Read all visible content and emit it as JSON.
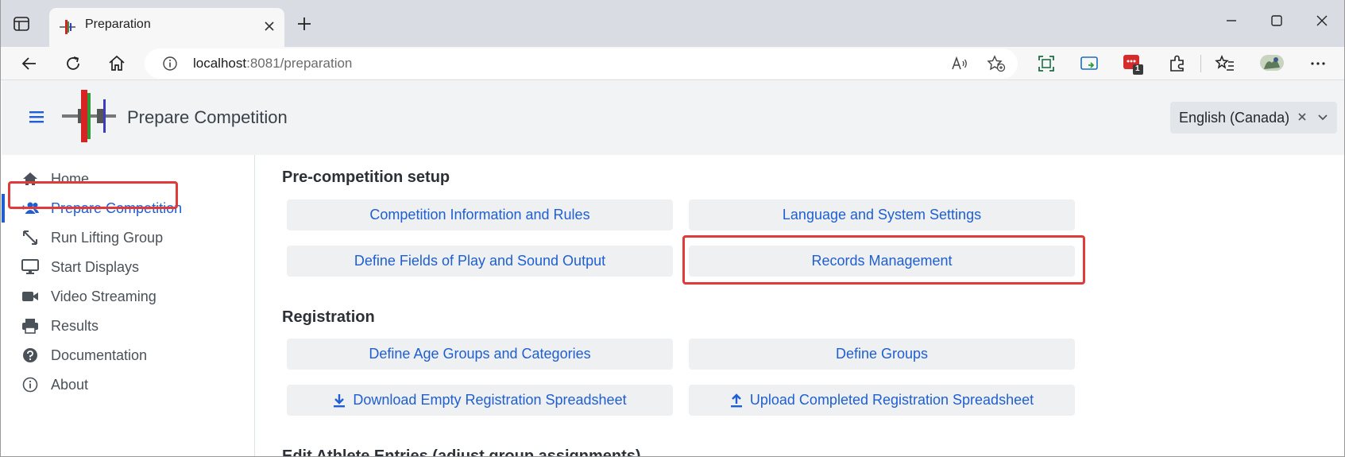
{
  "browser": {
    "tab_title": "Preparation",
    "url_host": "localhost",
    "url_rest": ":8081/preparation",
    "notification_badge": "1"
  },
  "header": {
    "title": "Prepare Competition",
    "language": "English (Canada)"
  },
  "sidebar": {
    "items": [
      {
        "label": "Home",
        "icon": "home-icon"
      },
      {
        "label": "Prepare Competition",
        "icon": "users-plus-icon",
        "active": true
      },
      {
        "label": "Run Lifting Group",
        "icon": "arrows-diagonal-icon"
      },
      {
        "label": "Start Displays",
        "icon": "desktop-icon"
      },
      {
        "label": "Video Streaming",
        "icon": "video-camera-icon"
      },
      {
        "label": "Results",
        "icon": "printer-icon"
      },
      {
        "label": "Documentation",
        "icon": "question-circle-icon"
      },
      {
        "label": "About",
        "icon": "info-circle-icon"
      }
    ]
  },
  "main": {
    "pre_setup": {
      "title": "Pre-competition setup",
      "competition_info": "Competition Information and Rules",
      "language_settings": "Language and System Settings",
      "fields_of_play": "Define Fields of Play and Sound Output",
      "records": "Records Management"
    },
    "registration": {
      "title": "Registration",
      "age_groups": "Define Age Groups and Categories",
      "groups": "Define Groups",
      "download": "Download Empty Registration Spreadsheet",
      "upload": "Upload Completed Registration Spreadsheet"
    },
    "edit_entries_title": "Edit Athlete Entries (adjust group assignments)"
  },
  "colors": {
    "accent": "#1f5fd1",
    "highlight": "#e03a3a",
    "button_bg": "#eef0f2",
    "header_bg": "#f1f3f5"
  }
}
